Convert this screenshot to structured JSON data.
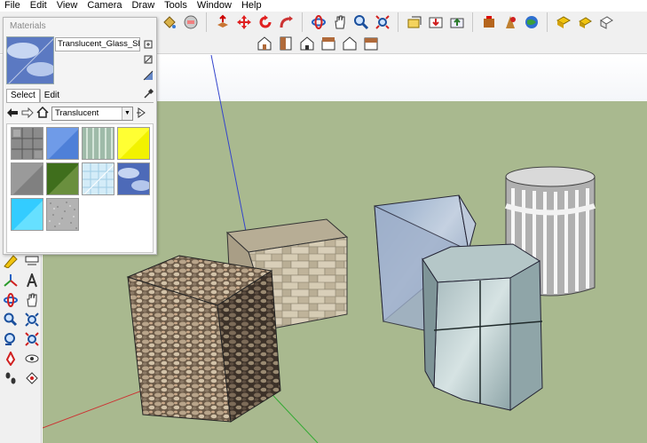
{
  "menubar": {
    "items": [
      "File",
      "Edit",
      "View",
      "Camera",
      "Draw",
      "Tools",
      "Window",
      "Help"
    ]
  },
  "materials_panel": {
    "title": "Materials",
    "material_name": "Translucent_Glass_Sky_I",
    "tabs": [
      "Select",
      "Edit"
    ],
    "active_tab": "Select",
    "library": "Translucent",
    "swatches": [
      "stone-grid",
      "blue-glass",
      "green-stripes",
      "yellow-glass",
      "gray-glass",
      "green-glass",
      "light-blue-grid",
      "sky-glass",
      "cyan-glass",
      "gray-noise"
    ]
  },
  "scene": {
    "objects": [
      "rocky-stone-cube",
      "stone-tile-cube",
      "translucent-glass-wedge",
      "white-fence-cylinder",
      "green-glass-hexagonal-prism"
    ],
    "background_color": "#a9b98f",
    "axis_colors": {
      "blue": "#3344cc",
      "green": "#33aa33",
      "red": "#cc3333"
    }
  }
}
